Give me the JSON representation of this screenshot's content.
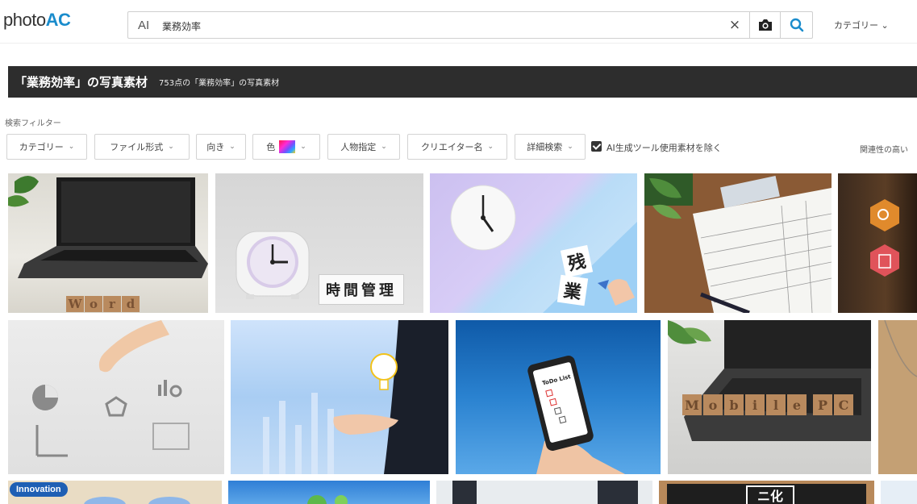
{
  "header": {
    "logo_prefix": "photo",
    "logo_brand": "AC",
    "ai_tag": "AI",
    "search_value": "業務効率",
    "clear_label": "×",
    "category_menu": "カテゴリー ⌄"
  },
  "title_bar": {
    "title": "「業務効率」の写真素材",
    "subtitle": "753点の「業務効率」の写真素材"
  },
  "filter_section_label": "検索フィルター",
  "filters": [
    {
      "label": "カテゴリー"
    },
    {
      "label": "ファイル形式"
    },
    {
      "label": "向き"
    },
    {
      "label": "色"
    },
    {
      "label": "人物指定"
    },
    {
      "label": "クリエイター名"
    },
    {
      "label": "詳細検索"
    }
  ],
  "ai_exclude": {
    "label": "AI生成ツール使用素材を除く",
    "checked": true
  },
  "sort_label": "関連性の高い",
  "photos": {
    "word_blocks": [
      "W",
      "o",
      "r",
      "d"
    ],
    "time_caption": "時間管理",
    "overtime_kanji": [
      "残",
      "業"
    ],
    "todo_label": "ToDo List",
    "mobile_blocks": [
      "M",
      "o",
      "b",
      "i",
      "l",
      "e",
      "P",
      "C"
    ],
    "innovation_label": "Innovation",
    "blackboard_text": "ニ化"
  },
  "colors": {
    "accent": "#1a8ccc",
    "title_bar": "#2d2d2d"
  }
}
